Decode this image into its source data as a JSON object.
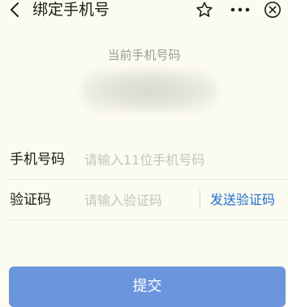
{
  "header": {
    "title": "绑定手机号",
    "icons": {
      "back": "chevron-left-icon",
      "favorite": "star-icon",
      "more": "more-dots-icon",
      "close": "close-circle-icon"
    }
  },
  "current_phone": {
    "label": "当前手机号码",
    "value_masked": true
  },
  "form": {
    "phone": {
      "label": "手机号码",
      "placeholder": "请输入11位手机号码",
      "value": ""
    },
    "code": {
      "label": "验证码",
      "placeholder": "请输入验证码",
      "value": "",
      "send_label": "发送验证码"
    }
  },
  "submit": {
    "label": "提交"
  },
  "colors": {
    "background": "#fcfbef",
    "accent": "#1f6fd1",
    "button": "#6b95dc"
  }
}
